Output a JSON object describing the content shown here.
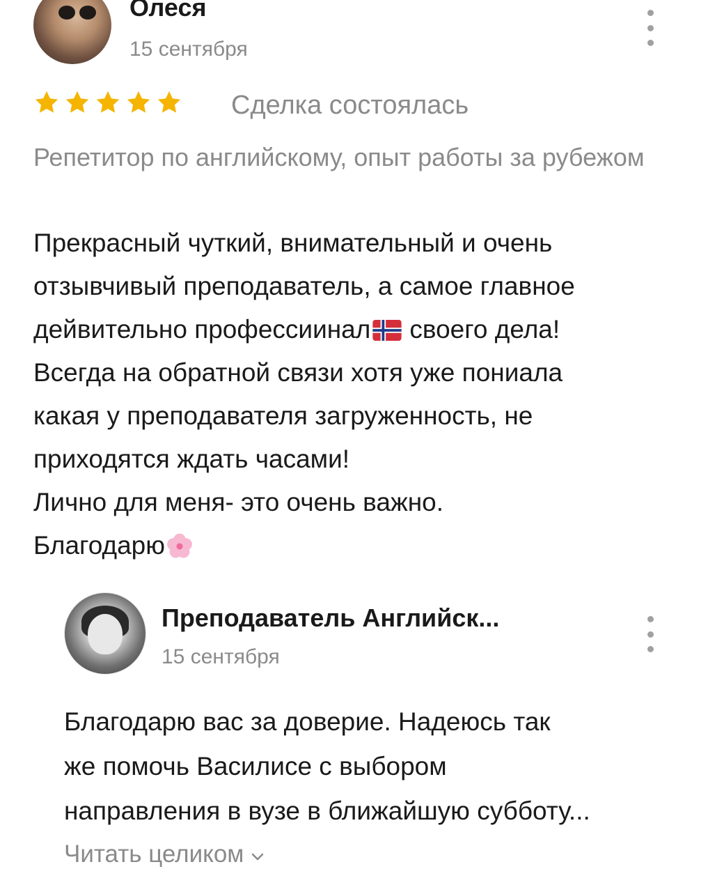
{
  "review": {
    "author_name": "Олеся",
    "date": "15 сентября",
    "rating": 5,
    "rating_max": 5,
    "deal_status": "Сделка состоялась",
    "service_title": "Репетитор по английскому, опыт работы за рубежом",
    "text_lines": [
      {
        "before": "Прекрасный чуткий, внимательный и очень",
        "after": ""
      },
      {
        "before": "отзывчивый преподаватель, а самое главное",
        "after": ""
      },
      {
        "before": "дейвительно профессиинал",
        "emoji": "flag-norway-icon",
        "after": "своего дела!"
      },
      {
        "before": "Всегда на обратной связи хотя уже пониала",
        "after": ""
      },
      {
        "before": "какая у преподавателя загруженность, не",
        "after": ""
      },
      {
        "before": "приходятся ждать часами!",
        "after": ""
      },
      {
        "before": "Лично для меня- это очень важно.",
        "after": ""
      },
      {
        "before": "Благодарю",
        "emoji": "cherry-blossom-icon",
        "after": ""
      }
    ],
    "colors": {
      "star": "#f5b400",
      "muted_text": "#8a8a8a",
      "main_text": "#1a1a1a"
    }
  },
  "reply": {
    "author_name": "Преподаватель Английск...",
    "date": "15 сентября",
    "text_lines": [
      "Благодарю вас за доверие. Надеюсь так",
      "же помочь Василисе с выбором",
      "направления в вузе в ближайшую субботу..."
    ],
    "read_more_label": "Читать целиком",
    "read_more_icon": "chevron-down-icon"
  },
  "icons": {
    "menu": "kebab-menu-icon",
    "star": "star-icon"
  }
}
